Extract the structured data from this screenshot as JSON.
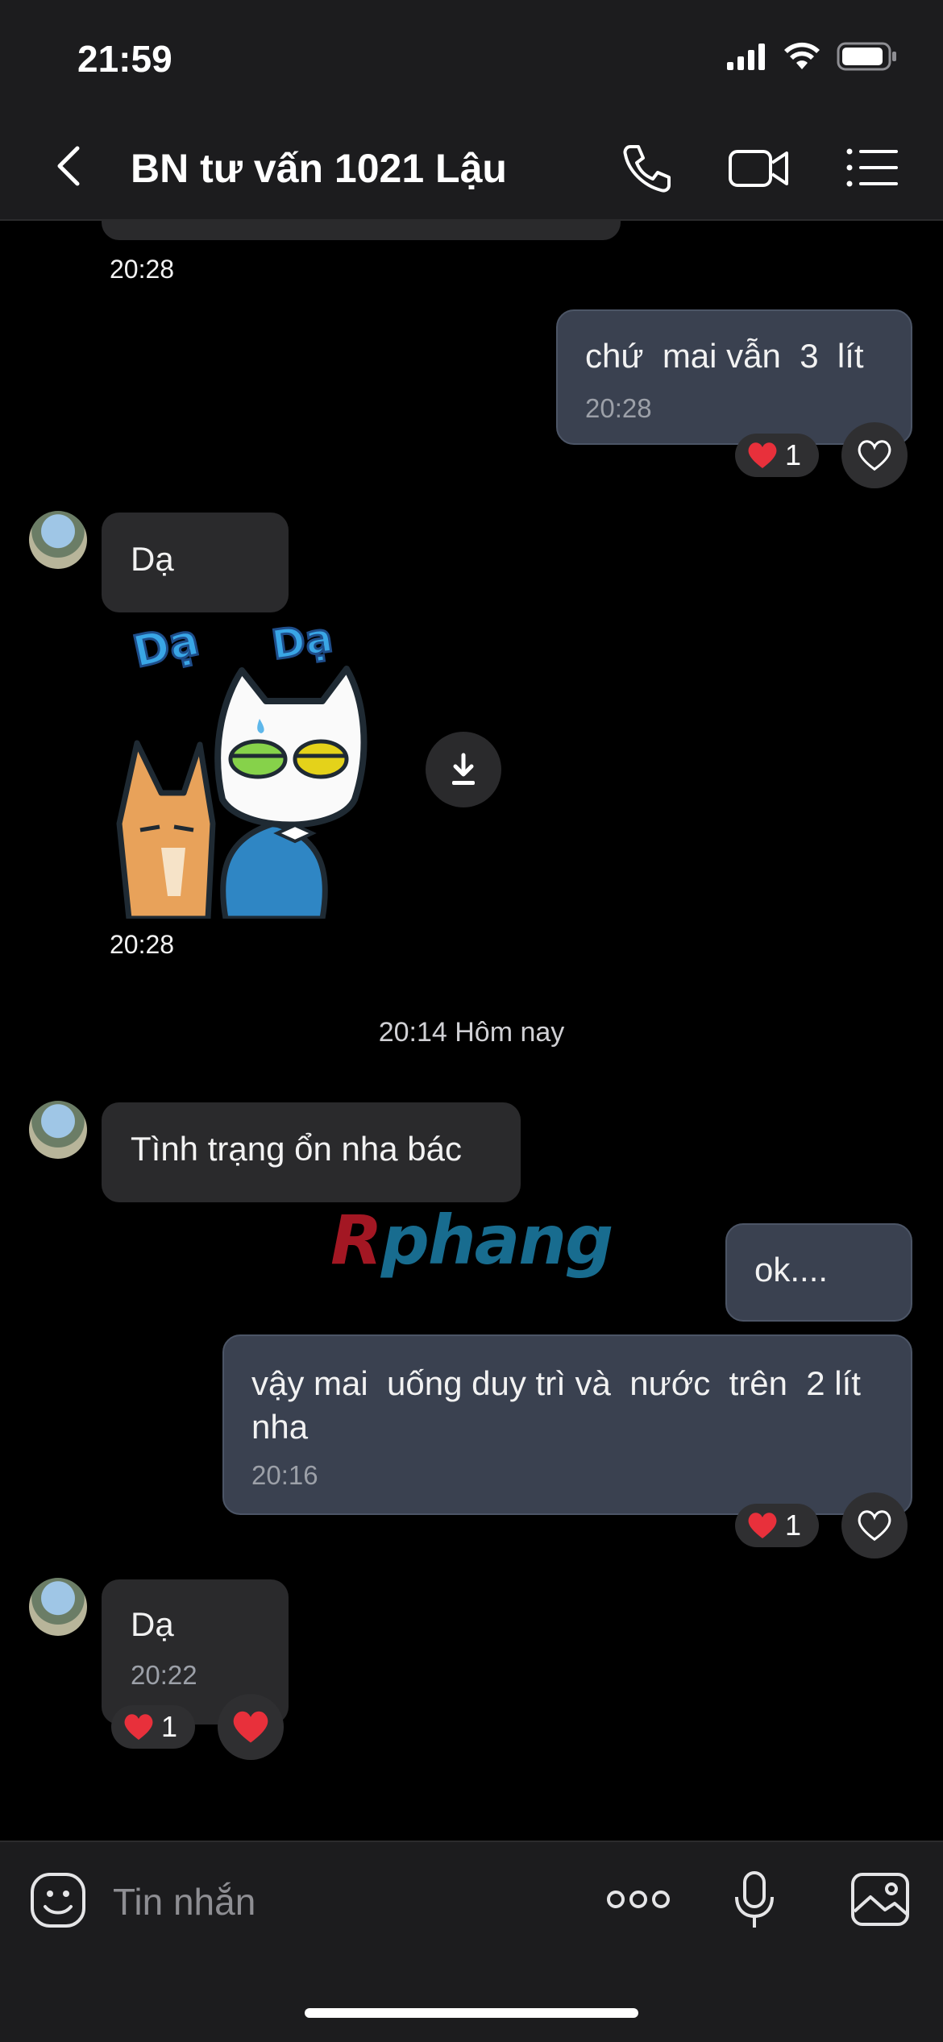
{
  "status": {
    "time": "21:59"
  },
  "header": {
    "title": "BN tư vấn 1021 Lậu"
  },
  "messages": {
    "ts_top": "20:28",
    "out1": {
      "text": "chứ  mai vẫn  3  lít",
      "time": "20:28",
      "reaction_count": "1"
    },
    "in1": {
      "text": "Dạ"
    },
    "sticker": {
      "text_left": "Dạ",
      "text_right": "Dạ",
      "time": "20:28"
    },
    "date_sep": "20:14 Hôm nay",
    "in2": {
      "text": "Tình trạng ổn nha bác"
    },
    "out2": {
      "text": "ok...."
    },
    "out3": {
      "text": "vậy mai  uống duy trì và  nước  trên  2 lít  nha",
      "time": "20:16",
      "reaction_count": "1"
    },
    "in3": {
      "text": "Dạ",
      "time": "20:22",
      "reaction_count": "1"
    }
  },
  "watermark": {
    "part1": "R",
    "part2": "phang"
  },
  "composer": {
    "placeholder": "Tin nhắn"
  },
  "colors": {
    "bg": "#000000",
    "bar": "#1c1c1e",
    "incoming": "#2a2a2c",
    "outgoing": "#3a4150",
    "heart": "#e8303b"
  }
}
